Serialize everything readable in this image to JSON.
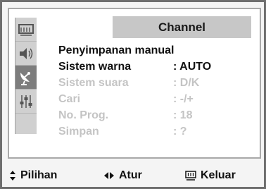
{
  "menu": {
    "header_title": "Channel",
    "section_title": "Penyimpanan manual",
    "items": [
      {
        "label": "Sistem warna",
        "value": ": AUTO",
        "enabled": true
      },
      {
        "label": "Sistem suara",
        "value": ": D/K",
        "enabled": false
      },
      {
        "label": "Cari",
        "value": ": -/+",
        "enabled": false
      },
      {
        "label": "No. Prog.",
        "value": ": 18",
        "enabled": false
      },
      {
        "label": "Simpan",
        "value": ": ?",
        "enabled": false
      }
    ]
  },
  "sidebar": {
    "icons": [
      {
        "name": "picture-icon",
        "active": false
      },
      {
        "name": "speaker-icon",
        "active": false
      },
      {
        "name": "satellite-dish-icon",
        "active": true
      },
      {
        "name": "equalizer-sliders-icon",
        "active": false
      }
    ]
  },
  "footer": {
    "select_label": "Pilihan",
    "adjust_label": "Atur",
    "exit_label": "Keluar"
  },
  "colors": {
    "enabled_text": "#111111",
    "disabled_text": "#c4c4c4",
    "header_bg": "#c7c7c7",
    "sidebar_active": "#7d7d7d"
  }
}
